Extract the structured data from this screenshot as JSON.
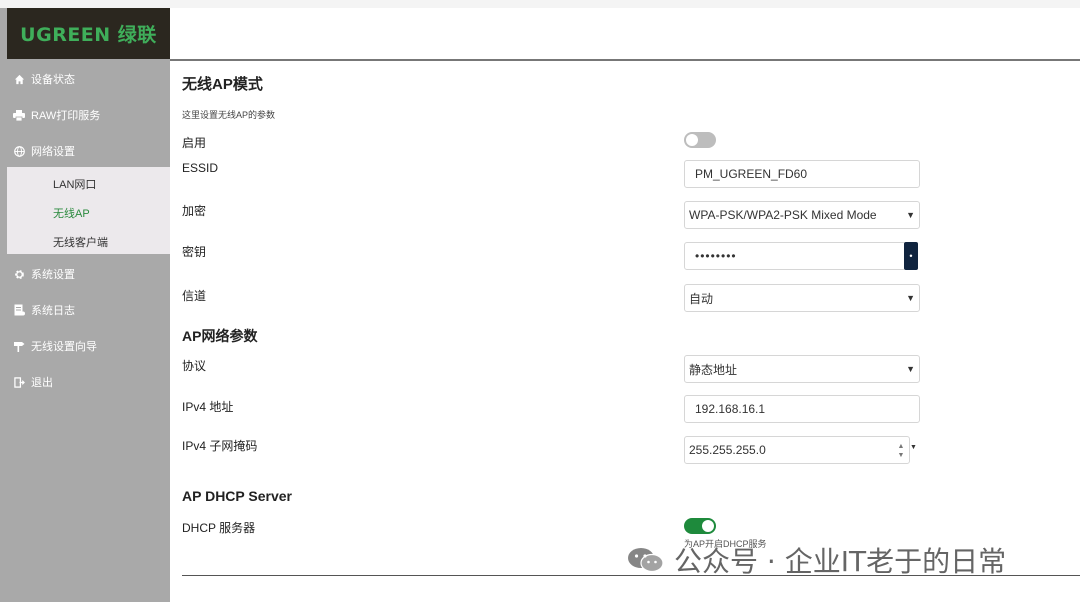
{
  "brand": {
    "logo_text": "UGREEN 绿联",
    "logo_color": "#3fae5a"
  },
  "sidebar": {
    "items": [
      {
        "label": "设备状态",
        "icon": "home-icon"
      },
      {
        "label": "RAW打印服务",
        "icon": "printer-icon"
      },
      {
        "label": "网络设置",
        "icon": "globe-icon"
      },
      {
        "label": "系统设置",
        "icon": "gear-icon"
      },
      {
        "label": "系统日志",
        "icon": "log-icon"
      },
      {
        "label": "无线设置向导",
        "icon": "signpost-icon"
      },
      {
        "label": "退出",
        "icon": "exit-icon"
      }
    ],
    "network_submenu": [
      {
        "label": "LAN网口"
      },
      {
        "label": "无线AP",
        "active": true
      },
      {
        "label": "无线客户端"
      }
    ]
  },
  "main": {
    "title": "无线AP模式",
    "description": "这里设置无线AP的参数",
    "enable": {
      "label": "启用",
      "on": false
    },
    "essid": {
      "label": "ESSID",
      "value": "PM_UGREEN_FD60"
    },
    "encryption": {
      "label": "加密",
      "value": "WPA-PSK/WPA2-PSK Mixed Mode"
    },
    "key": {
      "label": "密钥",
      "value": "••••••••"
    },
    "channel": {
      "label": "信道",
      "value": "自动"
    },
    "ap_net_title": "AP网络参数",
    "protocol": {
      "label": "协议",
      "value": "静态地址"
    },
    "ipv4": {
      "label": "IPv4 地址",
      "value": "192.168.16.1"
    },
    "netmask": {
      "label": "IPv4 子网掩码",
      "value": "255.255.255.0"
    },
    "dhcp_title": "AP DHCP Server",
    "dhcp": {
      "label": "DHCP 服务器",
      "on": true,
      "hint": "为AP开启DHCP服务"
    }
  },
  "watermark": {
    "text": "公众号 · 企业IT老于的日常",
    "icon": "wechat-icon"
  },
  "colors": {
    "accent_green": "#1e8a3c",
    "sidebar_bg": "#a9a9a9",
    "submenu_bg": "#ece9ec"
  }
}
